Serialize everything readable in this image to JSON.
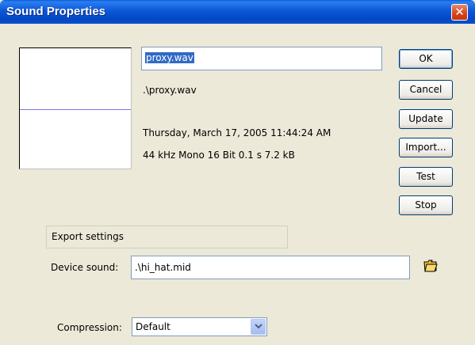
{
  "window": {
    "title": "Sound Properties",
    "close_glyph": "✕"
  },
  "sound": {
    "name_value": "proxy.wav",
    "path": ".\\proxy.wav",
    "date": "Thursday, March 17, 2005  11:44:24 AM",
    "format": "44 kHz Mono 16 Bit 0.1 s 7.2 kB"
  },
  "buttons": {
    "ok": "OK",
    "cancel": "Cancel",
    "update": "Update",
    "import": "Import...",
    "test": "Test",
    "stop": "Stop"
  },
  "export": {
    "group_label": "Export settings",
    "device_label": "Device sound:",
    "device_value": ".\\hi_hat.mid",
    "compression_label": "Compression:",
    "compression_value": "Default"
  },
  "icons": {
    "folder": "folder-icon",
    "dropdown": "chevron-down-icon"
  }
}
